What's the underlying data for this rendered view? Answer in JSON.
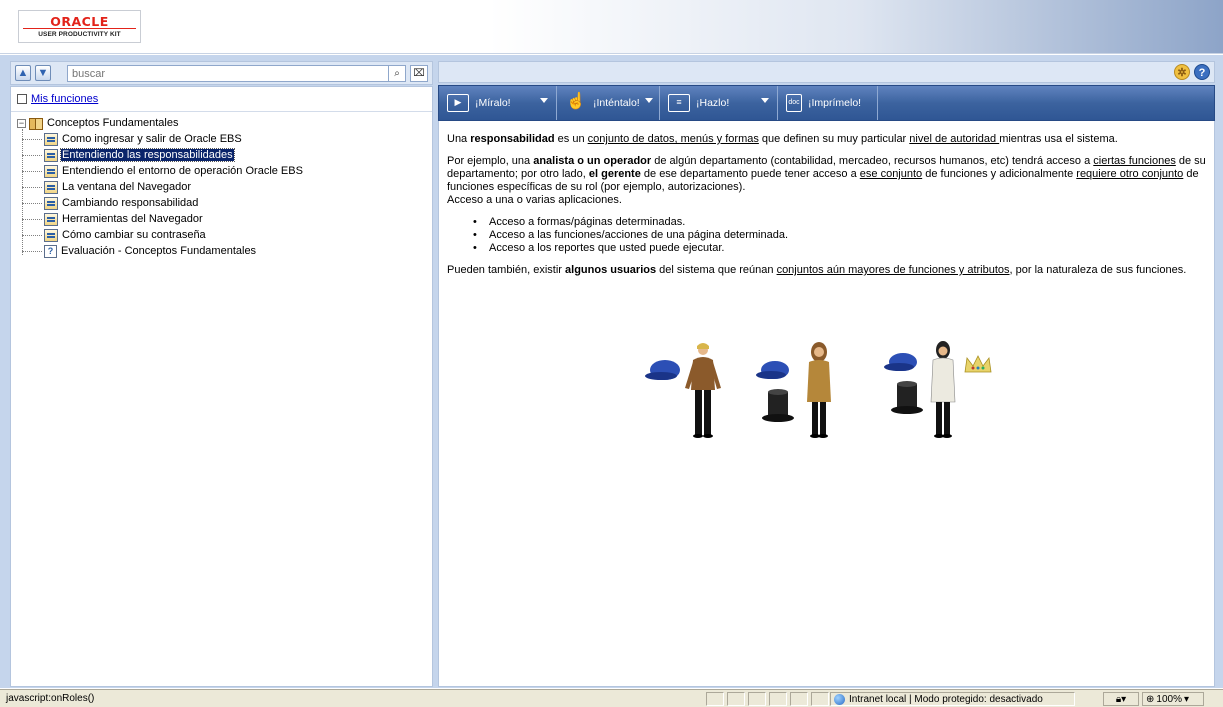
{
  "header": {
    "logo_brand": "ORACLE",
    "logo_product": "USER PRODUCTIVITY KIT"
  },
  "left": {
    "search_placeholder": "buscar",
    "mis_funciones": "Mis funciones",
    "tree": {
      "root": "Conceptos Fundamentales",
      "items": [
        {
          "label": "Como ingresar y salir de Oracle EBS",
          "icon": "topic-icon",
          "selected": false
        },
        {
          "label": "Entendiendo las responsabilidades",
          "icon": "topic-icon",
          "selected": true
        },
        {
          "label": "Entendiendo el entorno de operación Oracle EBS",
          "icon": "topic-icon",
          "selected": false
        },
        {
          "label": "La ventana del Navegador",
          "icon": "topic-icon",
          "selected": false
        },
        {
          "label": "Cambiando responsabilidad",
          "icon": "topic-icon",
          "selected": false
        },
        {
          "label": "Herramientas del Navegador",
          "icon": "topic-icon",
          "selected": false
        },
        {
          "label": "Cómo cambiar su contraseña",
          "icon": "topic-icon",
          "selected": false
        },
        {
          "label": "Evaluación - Conceptos Fundamentales",
          "icon": "evaluation-icon",
          "selected": false
        }
      ]
    }
  },
  "modes": [
    {
      "label": "¡Míralo!",
      "icon": "play-icon"
    },
    {
      "label": "¡Inténtalo!",
      "icon": "hand-icon"
    },
    {
      "label": "¡Hazlo!",
      "icon": "do-it-icon"
    },
    {
      "label": "¡Imprímelo!",
      "icon": "print-doc-icon"
    }
  ],
  "content": {
    "p1": {
      "a": "Una ",
      "b": "responsabilidad",
      "c": " es un ",
      "d": "conjunto de datos, menús y formas",
      "e": " que definen su muy particular ",
      "f": "nivel de autoridad ",
      "g": "mientras usa el sistema."
    },
    "p2": {
      "a": "Por ejemplo, una ",
      "b": "analista o un operador",
      "c": " de algún departamento (contabilidad, mercadeo, recursos humanos, etc) tendrá acceso a ",
      "d": "ciertas funciones",
      "e": " de su departamento; por otro lado, ",
      "f": "el gerente",
      "g": " de ese departamento puede tener acceso a ",
      "h": "ese conjunto",
      "i": " de funciones y adicionalmente ",
      "j": "requiere otro conjunto",
      "k": " de funciones específicas de su rol (por ejemplo, autorizaciones).",
      "l": "Acceso a una o varias aplicaciones."
    },
    "bullets": [
      "Acceso a formas/páginas determinadas.",
      "Acceso a las funciones/acciones de una página determinada.",
      "Acceso a los reportes que usted puede ejecutar."
    ],
    "p3": {
      "a": "Pueden también, existir ",
      "b": "algunos usuarios",
      "c": " del sistema que reúnan ",
      "d": "conjuntos aún mayores de funciones y atributos",
      "e": ", por la naturaleza de sus funciones."
    }
  },
  "status": {
    "text": "javascript:onRoles()",
    "zone": "Intranet local | Modo protegido: desactivado",
    "zoom": "100%"
  }
}
